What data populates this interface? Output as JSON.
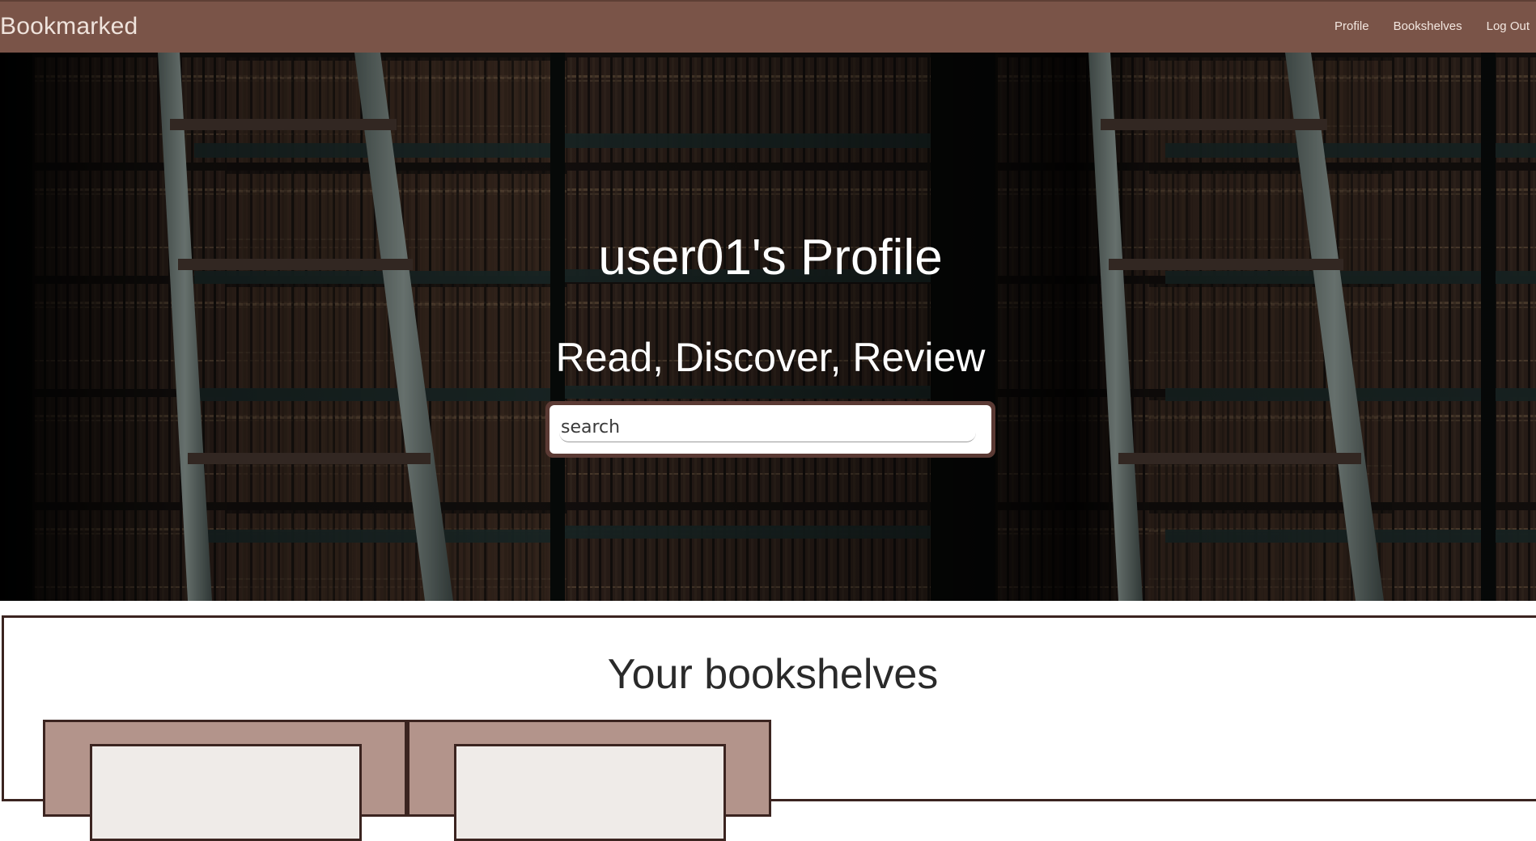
{
  "navbar": {
    "brand": "Bookmarked",
    "links": [
      "Profile",
      "Bookshelves",
      "Log Out"
    ]
  },
  "hero": {
    "title": "user01's Profile",
    "tagline": "Read, Discover, Review",
    "search_placeholder": "search"
  },
  "shelves": {
    "title": "Your bookshelves"
  },
  "colors": {
    "navbar": "#7a5448",
    "accent_dark": "#3b2420",
    "shelf_card": "#b3948b",
    "shelf_inner": "#efebe8"
  }
}
